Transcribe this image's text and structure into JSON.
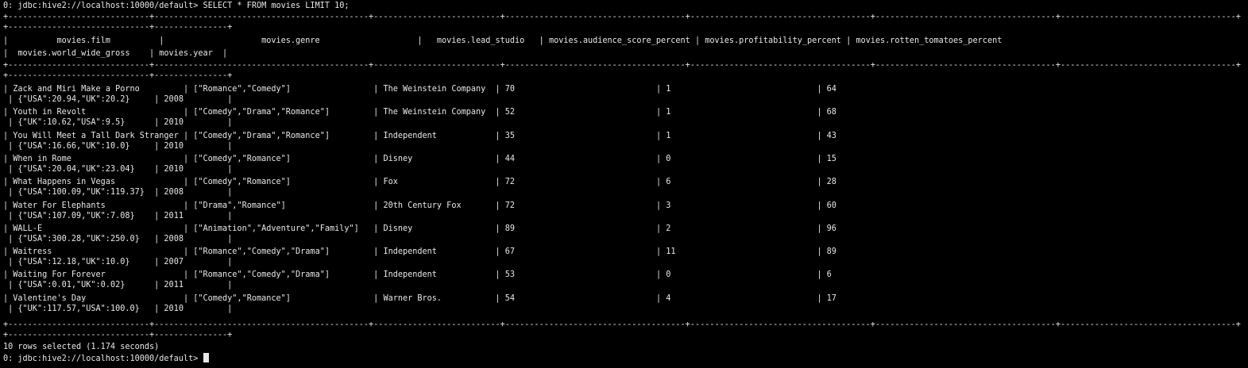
{
  "terminal": {
    "prompt": "0: jdbc:hive2://localhost:10000/default>",
    "command": "SELECT * FROM movies LIMIT 10;",
    "borders": {
      "top_a": "+-----------------------------+--------------------------------------------+--------------------------+-------------------------------------+-------------------------------------+-------------------------------------+------------------------------------+",
      "top_b": "+-----------------------------+---------------+",
      "mid_a": "+-----------------------------+--------------------------------------------+--------------------------+-------------------------------------+-------------------------------------+-------------------------------------+------------------------------------+",
      "mid_b": "+-----------------------------+---------------+",
      "bot_a": "+-----------------------------+--------------------------------------------+--------------------------+-------------------------------------+-------------------------------------+-------------------------------------+------------------------------------+",
      "bot_b": "+-----------------------------+---------------+"
    },
    "header_line_1": "|          movies.film          |                    movies.genre                    |   movies.lead_studio   | movies.audience_score_percent | movies.profitability_percent | movies.rotten_tomatoes_percent",
    "header_line_2": "|  movies.world_wide_gross    | movies.year  |",
    "columns": [
      "movies.film",
      "movies.genre",
      "movies.lead_studio",
      "movies.audience_score_percent",
      "movies.profitability_percent",
      "movies.rotten_tomatoes_percent",
      "movies.world_wide_gross",
      "movies.year"
    ],
    "rows": [
      {
        "film": "Zack and Miri Make a Porno",
        "genre": "[\"Romance\",\"Comedy\"]",
        "lead_studio": "The Weinstein Company",
        "audience_score_percent": "70",
        "profitability_percent": "1",
        "rotten_tomatoes_percent": "64",
        "world_wide_gross": "{\"USA\":20.94,\"UK\":20.2}",
        "year": "2008"
      },
      {
        "film": "Youth in Revolt",
        "genre": "[\"Comedy\",\"Drama\",\"Romance\"]",
        "lead_studio": "The Weinstein Company",
        "audience_score_percent": "52",
        "profitability_percent": "1",
        "rotten_tomatoes_percent": "68",
        "world_wide_gross": "{\"UK\":10.62,\"USA\":9.5}",
        "year": "2010"
      },
      {
        "film": "You Will Meet a Tall Dark Stranger",
        "genre": "[\"Comedy\",\"Drama\",\"Romance\"]",
        "lead_studio": "Independent",
        "audience_score_percent": "35",
        "profitability_percent": "1",
        "rotten_tomatoes_percent": "43",
        "world_wide_gross": "{\"USA\":16.66,\"UK\":10.0}",
        "year": "2010"
      },
      {
        "film": "When in Rome",
        "genre": "[\"Comedy\",\"Romance\"]",
        "lead_studio": "Disney",
        "audience_score_percent": "44",
        "profitability_percent": "0",
        "rotten_tomatoes_percent": "15",
        "world_wide_gross": "{\"USA\":20.04,\"UK\":23.04}",
        "year": "2010"
      },
      {
        "film": "What Happens in Vegas",
        "genre": "[\"Comedy\",\"Romance\"]",
        "lead_studio": "Fox",
        "audience_score_percent": "72",
        "profitability_percent": "6",
        "rotten_tomatoes_percent": "28",
        "world_wide_gross": "{\"USA\":100.09,\"UK\":119.37}",
        "year": "2008"
      },
      {
        "film": "Water For Elephants",
        "genre": "[\"Drama\",\"Romance\"]",
        "lead_studio": "20th Century Fox",
        "audience_score_percent": "72",
        "profitability_percent": "3",
        "rotten_tomatoes_percent": "60",
        "world_wide_gross": "{\"USA\":107.09,\"UK\":7.08}",
        "year": "2011"
      },
      {
        "film": "WALL-E",
        "genre": "[\"Animation\",\"Adventure\",\"Family\"]",
        "lead_studio": "Disney",
        "audience_score_percent": "89",
        "profitability_percent": "2",
        "rotten_tomatoes_percent": "96",
        "world_wide_gross": "{\"USA\":300.28,\"UK\":250.0}",
        "year": "2008"
      },
      {
        "film": "Waitress",
        "genre": "[\"Romance\",\"Comedy\",\"Drama\"]",
        "lead_studio": "Independent",
        "audience_score_percent": "67",
        "profitability_percent": "11",
        "rotten_tomatoes_percent": "89",
        "world_wide_gross": "{\"USA\":12.18,\"UK\":10.0}",
        "year": "2007"
      },
      {
        "film": "Waiting For Forever",
        "genre": "[\"Romance\",\"Comedy\",\"Drama\"]",
        "lead_studio": "Independent",
        "audience_score_percent": "53",
        "profitability_percent": "0",
        "rotten_tomatoes_percent": "6",
        "world_wide_gross": "{\"USA\":0.01,\"UK\":0.02}",
        "year": "2011"
      },
      {
        "film": "Valentine's Day",
        "genre": "[\"Comedy\",\"Romance\"]",
        "lead_studio": "Warner Bros.",
        "audience_score_percent": "54",
        "profitability_percent": "4",
        "rotten_tomatoes_percent": "17",
        "world_wide_gross": "{\"UK\":117.57,\"USA\":100.0}",
        "year": "2010"
      }
    ],
    "summary": "10 rows selected (1.174 seconds)",
    "colors": {
      "background": "#000000",
      "foreground": "#e8e8e8"
    }
  }
}
